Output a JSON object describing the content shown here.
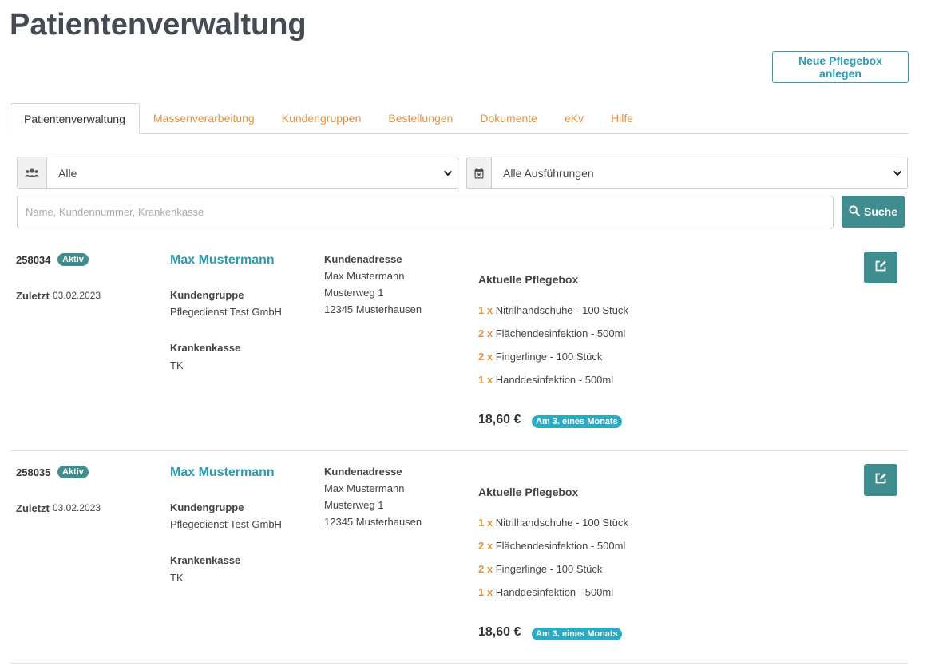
{
  "page": {
    "title": "Patientenverwaltung",
    "new_box_button": "Neue Pflegebox anlegen"
  },
  "tabs": [
    {
      "label": "Patientenverwaltung",
      "active": true
    },
    {
      "label": "Massenverarbeitung"
    },
    {
      "label": "Kundengruppen"
    },
    {
      "label": "Bestellungen"
    },
    {
      "label": "Dokumente"
    },
    {
      "label": "eKv"
    },
    {
      "label": "Hilfe"
    }
  ],
  "filters": {
    "group_select": {
      "icon": "users-icon",
      "value": "Alle"
    },
    "execution_select": {
      "icon": "calendar-x-icon",
      "value": "Alle Ausführungen"
    },
    "search_placeholder": "Name, Kundennummer, Krankenkasse",
    "search_button": "Suche"
  },
  "labels": {
    "last": "Zuletzt",
    "customer_group": "Kundengruppe",
    "insurance": "Krankenkasse",
    "address": "Kundenadresse",
    "current_box": "Aktuelle Pflegebox"
  },
  "patients": [
    {
      "id": "258034",
      "status": "Aktiv",
      "last_date": "03.02.2023",
      "name": "Max Mustermann",
      "customer_group": "Pflegedienst Test GmbH",
      "insurance": "TK",
      "address": [
        "Max Mustermann",
        "Musterweg 1",
        "12345 Musterhausen"
      ],
      "items": [
        {
          "qty": "1 x",
          "name": "Nitrilhandschuhe - 100 Stück"
        },
        {
          "qty": "2 x",
          "name": "Flächendesinfektion - 500ml"
        },
        {
          "qty": "2 x",
          "name": "Fingerlinge - 100 Stück"
        },
        {
          "qty": "1 x",
          "name": "Handdesinfektion - 500ml"
        }
      ],
      "price": "18,60 €",
      "schedule": "Am 3. eines Monats"
    },
    {
      "id": "258035",
      "status": "Aktiv",
      "last_date": "03.02.2023",
      "name": "Max Mustermann",
      "customer_group": "Pflegedienst Test GmbH",
      "insurance": "TK",
      "address": [
        "Max Mustermann",
        "Musterweg 1",
        "12345 Musterhausen"
      ],
      "items": [
        {
          "qty": "1 x",
          "name": "Nitrilhandschuhe - 100 Stück"
        },
        {
          "qty": "2 x",
          "name": "Flächendesinfektion - 500ml"
        },
        {
          "qty": "2 x",
          "name": "Fingerlinge - 100 Stück"
        },
        {
          "qty": "1 x",
          "name": "Handdesinfektion - 500ml"
        }
      ],
      "price": "18,60 €",
      "schedule": "Am 3. eines Monats"
    }
  ]
}
